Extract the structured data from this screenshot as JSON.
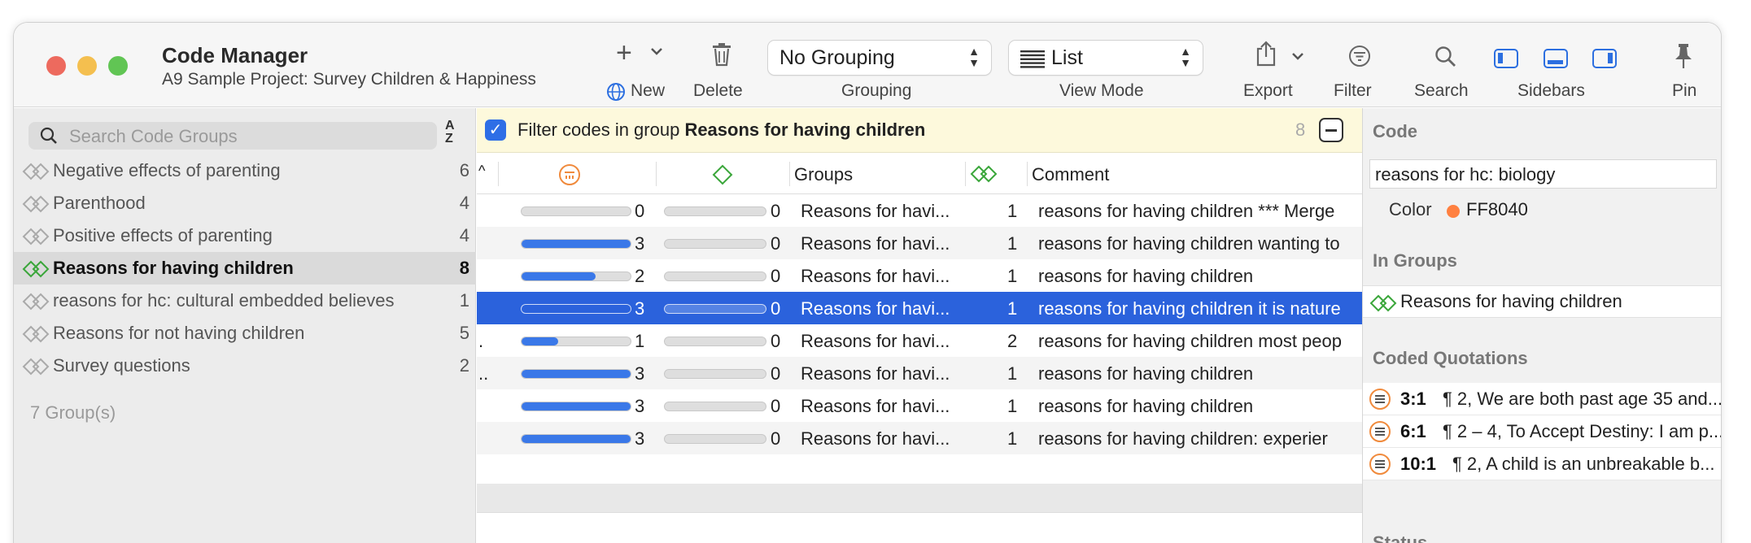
{
  "window": {
    "title": "Code Manager",
    "subtitle": "A9 Sample Project: Survey Children & Happiness"
  },
  "toolbar": {
    "new_label": "New",
    "delete_label": "Delete",
    "grouping_value": "No Grouping",
    "grouping_label": "Grouping",
    "viewmode_value": "List",
    "viewmode_label": "View Mode",
    "export_label": "Export",
    "filter_label": "Filter",
    "search_label": "Search",
    "sidebars_label": "Sidebars",
    "pin_label": "Pin"
  },
  "left": {
    "search_placeholder": "Search Code Groups",
    "groups": [
      {
        "label": "Negative effects of parenting",
        "count": "6"
      },
      {
        "label": "Parenthood",
        "count": "4"
      },
      {
        "label": "Positive effects of parenting",
        "count": "4"
      },
      {
        "label": "Reasons for having children",
        "count": "8"
      },
      {
        "label": "reasons for hc: cultural embedded believes",
        "count": "1"
      },
      {
        "label": "Reasons for not having children",
        "count": "5"
      },
      {
        "label": "Survey questions",
        "count": "2"
      }
    ],
    "group_count": "7 Group(s)"
  },
  "filter": {
    "prefix": "Filter codes in group ",
    "group": "Reasons for having children",
    "count": "8"
  },
  "table": {
    "col_groups": "Groups",
    "col_comment": "Comment",
    "rows": [
      {
        "q_fill": 0,
        "q": "0",
        "d_fill": 0,
        "d": "0",
        "groups": "Reasons for havi...",
        "gcount": "1",
        "comment": "reasons for having children *** Merge",
        "lead": ""
      },
      {
        "q_fill": 1.0,
        "q": "3",
        "d_fill": 0,
        "d": "0",
        "groups": "Reasons for havi...",
        "gcount": "1",
        "comment": "reasons for having children wanting to",
        "lead": ""
      },
      {
        "q_fill": 0.67,
        "q": "2",
        "d_fill": 0,
        "d": "0",
        "groups": "Reasons for havi...",
        "gcount": "1",
        "comment": "reasons for having children",
        "lead": ""
      },
      {
        "q_fill": 1.0,
        "q": "3",
        "d_fill": 0,
        "d": "0",
        "groups": "Reasons for havi...",
        "gcount": "1",
        "comment": "reasons for having children it is nature",
        "lead": ""
      },
      {
        "q_fill": 0.33,
        "q": "1",
        "d_fill": 0,
        "d": "0",
        "groups": "Reasons for havi...",
        "gcount": "2",
        "comment": "reasons for having children most peop",
        "lead": "."
      },
      {
        "q_fill": 1.0,
        "q": "3",
        "d_fill": 0,
        "d": "0",
        "groups": "Reasons for havi...",
        "gcount": "1",
        "comment": "reasons for having children",
        "lead": ".."
      },
      {
        "q_fill": 1.0,
        "q": "3",
        "d_fill": 0,
        "d": "0",
        "groups": "Reasons for havi...",
        "gcount": "1",
        "comment": "reasons for having children",
        "lead": ""
      },
      {
        "q_fill": 1.0,
        "q": "3",
        "d_fill": 0,
        "d": "0",
        "groups": "Reasons for havi...",
        "gcount": "1",
        "comment": "reasons for having children:   experier",
        "lead": ""
      }
    ]
  },
  "right": {
    "code_header": "Code",
    "code_value": "reasons for hc: biology",
    "color_label": "Color",
    "color_value": "FF8040",
    "in_groups_header": "In Groups",
    "in_group": "Reasons for having children",
    "coded_quotations_header": "Coded Quotations",
    "quotations": [
      {
        "id": "3:1",
        "text": "¶ 2, We are both past age 35 and..."
      },
      {
        "id": "6:1",
        "text": "¶ 2 – 4, To Accept Destiny:  I am p..."
      },
      {
        "id": "10:1",
        "text": "¶ 2, A child is an unbreakable b..."
      }
    ],
    "status_header": "Status"
  },
  "colors": {
    "accent": "#2b62dc",
    "code_color": "#ff8040",
    "group_icon": "#3aa63a"
  }
}
